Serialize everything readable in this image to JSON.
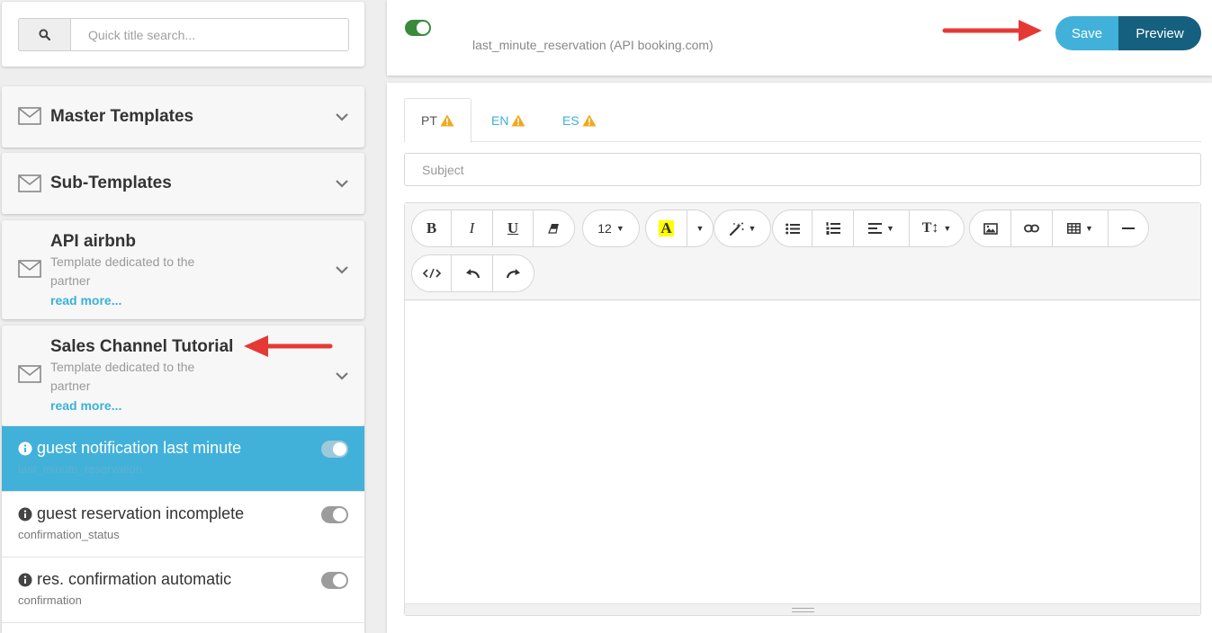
{
  "search": {
    "placeholder": "Quick title search...",
    "icon": "search-icon"
  },
  "accordion": [
    {
      "title": "Master Templates"
    },
    {
      "title": "Sub-Templates"
    },
    {
      "title": "API airbnb",
      "description": "Template dedicated to the partner",
      "link": "read more..."
    },
    {
      "title": "Sales Channel Tutorial",
      "description": "Template dedicated to the partner",
      "link": "read more..."
    }
  ],
  "templates": [
    {
      "name": "guest notification last minute",
      "code": "last_minute_reservation",
      "active": true
    },
    {
      "name": "guest reservation incomplete",
      "code": "confirmation_status",
      "active": false
    },
    {
      "name": "res. confirmation automatic",
      "code": "confirmation",
      "active": false
    }
  ],
  "header": {
    "template_ref": "last_minute_reservation (API booking.com)",
    "save_label": "Save",
    "preview_label": "Preview"
  },
  "tabs": [
    {
      "label": "PT",
      "active": true
    },
    {
      "label": "EN",
      "active": false
    },
    {
      "label": "ES",
      "active": false
    }
  ],
  "subject": {
    "placeholder": "Subject"
  },
  "toolbar": {
    "font_size": "12"
  },
  "colors": {
    "accent": "#41b1da",
    "dark_accent": "#15607f",
    "warning": "#f0a81c",
    "toggle_on": "#3a8a3c",
    "arrow": "#e53935"
  }
}
